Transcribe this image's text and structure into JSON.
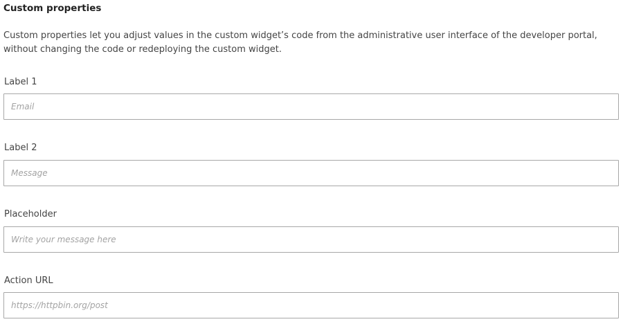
{
  "section": {
    "title": "Custom properties",
    "description": "Custom properties let you adjust values in the custom widget’s code from the administrative user interface of the developer portal, without changing the code or redeploying the custom widget."
  },
  "fields": [
    {
      "label": "Label 1",
      "value": "",
      "placeholder": "Email"
    },
    {
      "label": "Label 2",
      "value": "",
      "placeholder": "Message"
    },
    {
      "label": "Placeholder",
      "value": "",
      "placeholder": "Write your message here"
    },
    {
      "label": "Action URL",
      "value": "",
      "placeholder": "https://httpbin.org/post"
    }
  ]
}
